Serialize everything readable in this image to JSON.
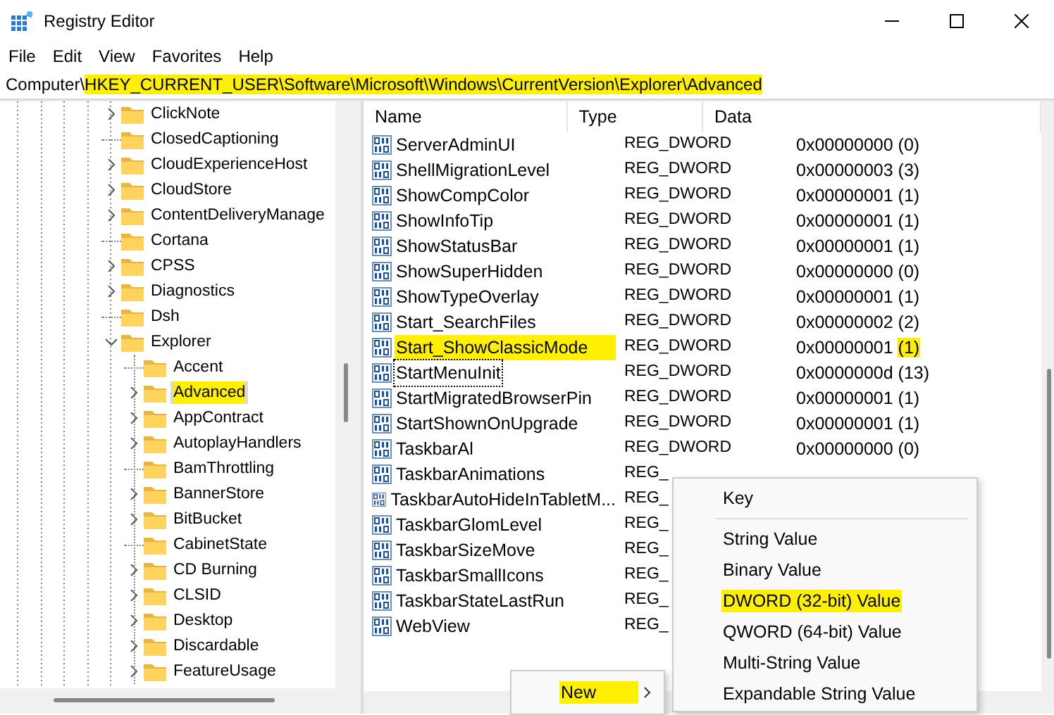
{
  "window": {
    "title": "Registry Editor"
  },
  "menu_bar": [
    "File",
    "Edit",
    "View",
    "Favorites",
    "Help"
  ],
  "address_bar": {
    "prefix": "Computer\\",
    "path": "HKEY_CURRENT_USER\\Software\\Microsoft\\Windows\\CurrentVersion\\Explorer\\Advanced",
    "path_highlighted": true
  },
  "tree": [
    {
      "label": "ClickNote",
      "has_children": true,
      "selected": false,
      "highlighted": false
    },
    {
      "label": "ClosedCaptioning",
      "has_children": false,
      "selected": false,
      "highlighted": false
    },
    {
      "label": "CloudExperienceHost",
      "has_children": true,
      "selected": false,
      "highlighted": false
    },
    {
      "label": "CloudStore",
      "has_children": true,
      "selected": false,
      "highlighted": false
    },
    {
      "label": "ContentDeliveryManage",
      "has_children": true,
      "selected": false,
      "highlighted": false
    },
    {
      "label": "Cortana",
      "has_children": false,
      "selected": false,
      "highlighted": false
    },
    {
      "label": "CPSS",
      "has_children": true,
      "selected": false,
      "highlighted": false
    },
    {
      "label": "Diagnostics",
      "has_children": true,
      "selected": false,
      "highlighted": false
    },
    {
      "label": "Dsh",
      "has_children": false,
      "selected": false,
      "highlighted": false
    },
    {
      "label": "Explorer",
      "has_children": true,
      "expanded": true,
      "selected": false,
      "highlighted": false,
      "children": [
        {
          "label": "Accent",
          "has_children": false,
          "selected": false,
          "highlighted": false
        },
        {
          "label": "Advanced",
          "has_children": true,
          "selected": true,
          "highlighted": true
        },
        {
          "label": "AppContract",
          "has_children": true,
          "selected": false,
          "highlighted": false
        },
        {
          "label": "AutoplayHandlers",
          "has_children": true,
          "selected": false,
          "highlighted": false
        },
        {
          "label": "BamThrottling",
          "has_children": false,
          "selected": false,
          "highlighted": false
        },
        {
          "label": "BannerStore",
          "has_children": true,
          "selected": false,
          "highlighted": false
        },
        {
          "label": "BitBucket",
          "has_children": true,
          "selected": false,
          "highlighted": false
        },
        {
          "label": "CabinetState",
          "has_children": false,
          "selected": false,
          "highlighted": false
        },
        {
          "label": "CD Burning",
          "has_children": true,
          "selected": false,
          "highlighted": false
        },
        {
          "label": "CLSID",
          "has_children": true,
          "selected": false,
          "highlighted": false
        },
        {
          "label": "Desktop",
          "has_children": true,
          "selected": false,
          "highlighted": false
        },
        {
          "label": "Discardable",
          "has_children": true,
          "selected": false,
          "highlighted": false
        },
        {
          "label": "FeatureUsage",
          "has_children": true,
          "selected": false,
          "highlighted": false
        }
      ]
    }
  ],
  "table": {
    "columns": [
      "Name",
      "Type",
      "Data"
    ],
    "rows": [
      {
        "name": "ServerAdminUI",
        "type": "REG_DWORD",
        "data": "0x00000000",
        "data_decimal": "(0)"
      },
      {
        "name": "ShellMigrationLevel",
        "type": "REG_DWORD",
        "data": "0x00000003",
        "data_decimal": "(3)"
      },
      {
        "name": "ShowCompColor",
        "type": "REG_DWORD",
        "data": "0x00000001",
        "data_decimal": "(1)"
      },
      {
        "name": "ShowInfoTip",
        "type": "REG_DWORD",
        "data": "0x00000001",
        "data_decimal": "(1)"
      },
      {
        "name": "ShowStatusBar",
        "type": "REG_DWORD",
        "data": "0x00000001",
        "data_decimal": "(1)"
      },
      {
        "name": "ShowSuperHidden",
        "type": "REG_DWORD",
        "data": "0x00000000",
        "data_decimal": "(0)"
      },
      {
        "name": "ShowTypeOverlay",
        "type": "REG_DWORD",
        "data": "0x00000001",
        "data_decimal": "(1)"
      },
      {
        "name": "Start_SearchFiles",
        "type": "REG_DWORD",
        "data": "0x00000002",
        "data_decimal": "(2)"
      },
      {
        "name": "Start_ShowClassicMode",
        "type": "REG_DWORD",
        "data": "0x00000001",
        "data_decimal": "(1)",
        "name_highlighted": true,
        "decimal_highlighted": true
      },
      {
        "name": "StartMenuInit",
        "type": "REG_DWORD",
        "data": "0x0000000d",
        "data_decimal": "(13)",
        "focused": true
      },
      {
        "name": "StartMigratedBrowserPin",
        "type": "REG_DWORD",
        "data": "0x00000001",
        "data_decimal": "(1)"
      },
      {
        "name": "StartShownOnUpgrade",
        "type": "REG_DWORD",
        "data": "0x00000001",
        "data_decimal": "(1)"
      },
      {
        "name": "TaskbarAl",
        "type": "REG_DWORD",
        "data": "0x00000000",
        "data_decimal": "(0)"
      },
      {
        "name": "TaskbarAnimations",
        "type": "REG_"
      },
      {
        "name": "TaskbarAutoHideInTabletM...",
        "type": "REG_"
      },
      {
        "name": "TaskbarGlomLevel",
        "type": "REG_"
      },
      {
        "name": "TaskbarSizeMove",
        "type": "REG_"
      },
      {
        "name": "TaskbarSmallIcons",
        "type": "REG_"
      },
      {
        "name": "TaskbarStateLastRun",
        "type": "REG_"
      },
      {
        "name": "WebView",
        "type": "REG_"
      }
    ]
  },
  "context_menu": {
    "items": [
      {
        "label": "New",
        "has_submenu": true,
        "highlighted": true
      }
    ]
  },
  "submenu": {
    "items": [
      {
        "label": "Key",
        "highlighted": false,
        "separator_after": true
      },
      {
        "label": "String Value",
        "highlighted": false
      },
      {
        "label": "Binary Value",
        "highlighted": false
      },
      {
        "label": "DWORD (32-bit) Value",
        "highlighted": true
      },
      {
        "label": "QWORD (64-bit) Value",
        "highlighted": false
      },
      {
        "label": "Multi-String Value",
        "highlighted": false
      },
      {
        "label": "Expandable String Value",
        "highlighted": false
      }
    ]
  }
}
